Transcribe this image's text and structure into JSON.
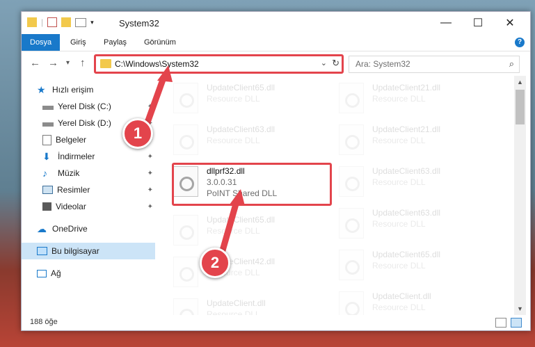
{
  "window": {
    "title": "System32",
    "controls": {
      "minimize": "—",
      "maximize": "☐",
      "close": "✕"
    }
  },
  "ribbon": {
    "tabs": [
      "Dosya",
      "Giriş",
      "Paylaş",
      "Görünüm"
    ],
    "help": "?"
  },
  "nav": {
    "address": "C:\\Windows\\System32",
    "search_placeholder": "Ara: System32"
  },
  "sidebar": {
    "items": [
      {
        "label": "Hızlı erişim",
        "icon": "star-icon"
      },
      {
        "label": "Yerel Disk (C:)",
        "icon": "drive-icon"
      },
      {
        "label": "Yerel Disk (D:)",
        "icon": "drive-icon"
      },
      {
        "label": "Belgeler",
        "icon": "documents-icon"
      },
      {
        "label": "İndirmeler",
        "icon": "download-icon"
      },
      {
        "label": "Müzik",
        "icon": "music-icon"
      },
      {
        "label": "Resimler",
        "icon": "pictures-icon"
      },
      {
        "label": "Videolar",
        "icon": "video-icon"
      },
      {
        "label": "OneDrive",
        "icon": "cloud-icon"
      },
      {
        "label": "Bu bilgisayar",
        "icon": "computer-icon"
      },
      {
        "label": "Ağ",
        "icon": "network-icon"
      }
    ]
  },
  "files": {
    "left": [
      {
        "name": "UpdateClient65.dll",
        "desc": "Resource DLL"
      },
      {
        "name": "UpdateClient63.dll",
        "desc": "Resource DLL"
      },
      {
        "name": "dllprf32.dll",
        "version": "3.0.0.31",
        "desc": "PoINT Shared DLL"
      },
      {
        "name": "UpdateClient65.dll",
        "desc": "Resource DLL"
      },
      {
        "name": "UpdateClient42.dll",
        "desc": "Resource DLL"
      },
      {
        "name": "UpdateClient.dll",
        "desc": "Resource DLL"
      }
    ],
    "right": [
      {
        "name": "UpdateClient21.dll",
        "desc": "Resource DLL"
      },
      {
        "name": "UpdateClient21.dll",
        "desc": "Resource DLL"
      },
      {
        "name": "UpdateClient63.dll",
        "desc": "Resource DLL"
      },
      {
        "name": "UpdateClient63.dll",
        "desc": "Resource DLL"
      },
      {
        "name": "UpdateClient65.dll",
        "desc": "Resource DLL"
      },
      {
        "name": "UpdateClient.dll",
        "desc": "Resource DLL"
      }
    ]
  },
  "status": {
    "count": "188 öğe"
  },
  "callouts": [
    "1",
    "2"
  ],
  "colors": {
    "accent": "#1979ca",
    "highlight": "#e3444c"
  }
}
